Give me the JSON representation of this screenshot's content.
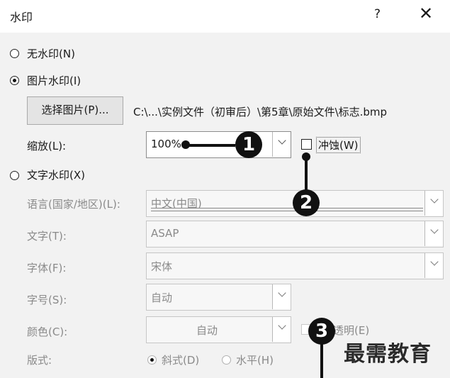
{
  "dialog": {
    "title": "水印",
    "help": "?",
    "close": "✕"
  },
  "options": {
    "no_watermark": "无水印(N)",
    "picture_watermark": "图片水印(I)",
    "text_watermark": "文字水印(X)"
  },
  "picture": {
    "select_button": "选择图片(P)...",
    "file_path": "C:\\...\\实例文件（初审后）\\第5章\\原始文件\\标志.bmp",
    "scale_label": "缩放(L):",
    "scale_value": "100%",
    "washout_label": "冲蚀(W)"
  },
  "text": {
    "language_label": "语言(国家/地区)(L):",
    "language_value": "中文(中国)",
    "text_label": "文字(T):",
    "text_value": "ASAP",
    "font_label": "字体(F):",
    "font_value": "宋体",
    "size_label": "字号(S):",
    "size_value": "自动",
    "color_label": "颜色(C):",
    "color_value": "自动",
    "semitransparent_label": "透明(E)",
    "layout_label": "版式:",
    "diagonal_label": "斜式(D)",
    "horizontal_label": "水平(H)"
  },
  "callouts": [
    "1",
    "2",
    "3"
  ],
  "watermark_text": "最需教育"
}
